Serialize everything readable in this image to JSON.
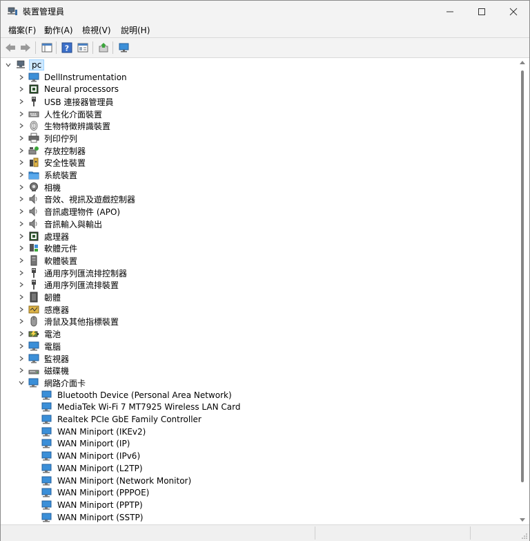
{
  "window": {
    "title": "裝置管理員"
  },
  "menu": [
    "檔案(F)",
    "動作(A)",
    "檢視(V)",
    "說明(H)"
  ],
  "toolbar": {
    "buttons": [
      "back-icon",
      "forward-icon",
      "properties-sheet-icon",
      "help-icon",
      "console-tree-icon",
      "update-driver-icon",
      "scan-hardware-icon"
    ]
  },
  "tree": {
    "root": "pc",
    "categories": [
      {
        "label": "DellInstrumentation",
        "icon": "monitor-icon"
      },
      {
        "label": "Neural processors",
        "icon": "chip-icon"
      },
      {
        "label": "USB 連接器管理員",
        "icon": "usb-icon"
      },
      {
        "label": "人性化介面裝置",
        "icon": "hid-icon"
      },
      {
        "label": "生物特徵辨識裝置",
        "icon": "fingerprint-icon"
      },
      {
        "label": "列印佇列",
        "icon": "printer-icon"
      },
      {
        "label": "存放控制器",
        "icon": "storage-controller-icon"
      },
      {
        "label": "安全性裝置",
        "icon": "security-icon"
      },
      {
        "label": "系統裝置",
        "icon": "folder-icon"
      },
      {
        "label": "相機",
        "icon": "camera-icon"
      },
      {
        "label": "音效、視訊及遊戲控制器",
        "icon": "speaker-icon"
      },
      {
        "label": "音訊處理物件 (APO)",
        "icon": "speaker-icon"
      },
      {
        "label": "音訊輸入與輸出",
        "icon": "speaker-icon"
      },
      {
        "label": "處理器",
        "icon": "chip-icon"
      },
      {
        "label": "軟體元件",
        "icon": "software-component-icon"
      },
      {
        "label": "軟體裝置",
        "icon": "software-device-icon"
      },
      {
        "label": "通用序列匯流排控制器",
        "icon": "usb-icon"
      },
      {
        "label": "通用序列匯流排裝置",
        "icon": "usb-icon"
      },
      {
        "label": "韌體",
        "icon": "firmware-icon"
      },
      {
        "label": "感應器",
        "icon": "sensor-icon"
      },
      {
        "label": "滑鼠及其他指標裝置",
        "icon": "mouse-icon"
      },
      {
        "label": "電池",
        "icon": "battery-icon"
      },
      {
        "label": "電腦",
        "icon": "computer-icon"
      },
      {
        "label": "監視器",
        "icon": "monitor-icon"
      },
      {
        "label": "磁碟機",
        "icon": "disk-icon"
      },
      {
        "label": "網路介面卡",
        "icon": "network-adapter-icon",
        "expanded": true
      }
    ],
    "network_adapters": [
      "Bluetooth Device (Personal Area Network)",
      "MediaTek Wi-Fi 7 MT7925 Wireless LAN Card",
      "Realtek PCIe GbE Family Controller",
      "WAN Miniport (IKEv2)",
      "WAN Miniport (IP)",
      "WAN Miniport (IPv6)",
      "WAN Miniport (L2TP)",
      "WAN Miniport (Network Monitor)",
      "WAN Miniport (PPPOE)",
      "WAN Miniport (PPTP)",
      "WAN Miniport (SSTP)"
    ]
  }
}
